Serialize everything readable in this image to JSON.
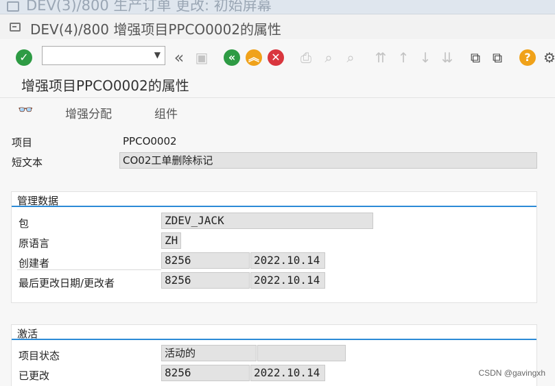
{
  "background_window": {
    "title": "DEV(3)/800 生产订单 更改: 初始屏幕"
  },
  "window": {
    "title": "DEV(4)/800 增强项目PPCO0002的属性"
  },
  "toolbar": {
    "command_field_value": ""
  },
  "page": {
    "heading": "增强项目PPCO0002的属性"
  },
  "app_toolbar": {
    "enh_assign_label": "增强分配",
    "components_label": "组件"
  },
  "header_fields": {
    "project_label": "项目",
    "project_value": "PPCO0002",
    "short_text_label": "短文本",
    "short_text_value": "CO02工单删除标记"
  },
  "mgmt": {
    "title": "管理数据",
    "package_label": "包",
    "package_value": "ZDEV_JACK",
    "orig_lang_label": "原语言",
    "orig_lang_value": "ZH",
    "created_by_label": "创建者",
    "created_by_value": "8256",
    "created_date": "2022.10.14",
    "changed_label": "最后更改日期/更改者",
    "changed_by_value": "8256",
    "changed_date": "2022.10.14"
  },
  "activation": {
    "title": "激活",
    "status_label": "项目状态",
    "status_value": "活动的",
    "status_extra": "",
    "changed_label": "已更改",
    "changed_by_value": "8256",
    "changed_date": "2022.10.14"
  },
  "watermark": "CSDN @gavingxh",
  "colors": {
    "ok_green": "#2e9b44",
    "nav_green": "#2e9b44",
    "nav_orange": "#f0a21a",
    "cancel_red": "#d9363e",
    "help_orange": "#f0a21a",
    "group_line": "#2b8ad6"
  }
}
